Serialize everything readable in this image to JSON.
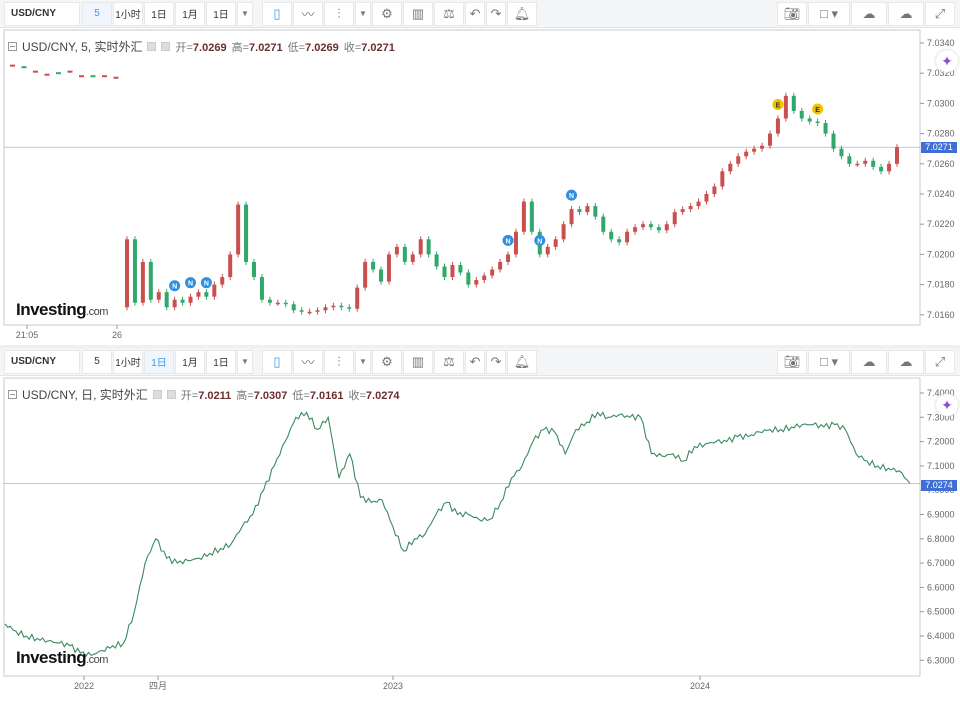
{
  "top": {
    "toolbar": {
      "symbol": "USD/CNY",
      "timeframes": [
        "5",
        "1小时",
        "1日",
        "1月",
        "1日"
      ],
      "active_tf": 0
    },
    "legend": {
      "title": "USD/CNY, 5, 实时外汇",
      "open_label": "开=",
      "open": "7.0269",
      "high_label": "高=",
      "high": "7.0271",
      "low_label": "低=",
      "low": "7.0269",
      "close_label": "收=",
      "close": "7.0271"
    },
    "logo": {
      "main": "Investing",
      "suffix": ".com"
    },
    "last_price": "7.0271"
  },
  "bottom": {
    "toolbar": {
      "symbol": "USD/CNY",
      "timeframes": [
        "5",
        "1小时",
        "1日",
        "1月",
        "1日"
      ],
      "active_tf": 2
    },
    "legend": {
      "title": "USD/CNY, 日, 实时外汇",
      "open_label": "开=",
      "open": "7.0211",
      "high_label": "高=",
      "high": "7.0307",
      "low_label": "低=",
      "low": "7.0161",
      "close_label": "收=",
      "close": "7.0274"
    },
    "logo": {
      "main": "Investing",
      "suffix": ".com"
    },
    "last_price": "7.0274"
  },
  "colors": {
    "up": "#c9504f",
    "down": "#2ea86b",
    "line": "#3a8a5f",
    "accent": "#3d9ae8",
    "last_price_bg": "#3d6fd6"
  },
  "chart_data": [
    {
      "type": "candlestick",
      "title": "USD/CNY, 5, 实时外汇",
      "ylim": [
        7.015,
        7.0345
      ],
      "y_ticks": [
        "7.0340",
        "7.0320",
        "7.0300",
        "7.0280",
        "7.0260",
        "7.0240",
        "7.0220",
        "7.0200",
        "7.0180",
        "7.0160"
      ],
      "x_ticks": [
        "21:05",
        "26"
      ],
      "prev_session_closes": [
        7.0325,
        7.0324,
        7.0321,
        7.0319,
        7.032,
        7.0321,
        7.0318,
        7.0318,
        7.0318,
        7.0317
      ],
      "closes": [
        7.021,
        7.0168,
        7.0195,
        7.017,
        7.0175,
        7.0165,
        7.017,
        7.0168,
        7.0172,
        7.0175,
        7.0172,
        7.018,
        7.0185,
        7.02,
        7.0233,
        7.0195,
        7.0185,
        7.017,
        7.0168,
        7.0168,
        7.0167,
        7.0163,
        7.0162,
        7.0162,
        7.0163,
        7.0165,
        7.0166,
        7.0165,
        7.0164,
        7.0178,
        7.0195,
        7.019,
        7.0182,
        7.02,
        7.0205,
        7.0195,
        7.02,
        7.021,
        7.02,
        7.0192,
        7.0185,
        7.0193,
        7.0188,
        7.018,
        7.0183,
        7.0186,
        7.019,
        7.0195,
        7.02,
        7.0215,
        7.0235,
        7.0215,
        7.02,
        7.0205,
        7.021,
        7.022,
        7.023,
        7.0228,
        7.0232,
        7.0225,
        7.0215,
        7.021,
        7.0208,
        7.0215,
        7.0218,
        7.022,
        7.0218,
        7.0216,
        7.022,
        7.0228,
        7.023,
        7.0232,
        7.0235,
        7.024,
        7.0245,
        7.0255,
        7.026,
        7.0265,
        7.0268,
        7.027,
        7.0272,
        7.028,
        7.029,
        7.0305,
        7.0295,
        7.029,
        7.0288,
        7.0287,
        7.028,
        7.027,
        7.0265,
        7.026,
        7.026,
        7.0262,
        7.0258,
        7.0255,
        7.026,
        7.0271
      ],
      "events": [
        {
          "label": "N",
          "index": 6
        },
        {
          "label": "N",
          "index": 8
        },
        {
          "label": "N",
          "index": 10
        },
        {
          "label": "N",
          "index": 48
        },
        {
          "label": "N",
          "index": 52
        },
        {
          "label": "N",
          "index": 56
        },
        {
          "label": "E",
          "index": 82
        },
        {
          "label": "E",
          "index": 87
        }
      ],
      "last": 7.0271
    },
    {
      "type": "line",
      "title": "USD/CNY, 日, 实时外汇",
      "ylim": [
        6.25,
        7.42
      ],
      "y_ticks": [
        "7.4000",
        "7.3000",
        "7.2000",
        "7.1000",
        "7.0000",
        "6.9000",
        "6.8000",
        "6.7000",
        "6.6000",
        "6.5000",
        "6.4000",
        "6.3000"
      ],
      "x_ticks": [
        "2022",
        "四月",
        "2023",
        "2024"
      ],
      "values": [
        6.45,
        6.42,
        6.4,
        6.39,
        6.38,
        6.37,
        6.36,
        6.33,
        6.32,
        6.34,
        6.36,
        6.37,
        6.5,
        6.7,
        6.8,
        6.72,
        6.7,
        6.71,
        6.72,
        6.74,
        6.76,
        6.78,
        6.85,
        6.9,
        7.0,
        7.1,
        7.2,
        7.3,
        7.32,
        7.25,
        7.3,
        7.05,
        7.15,
        6.97,
        6.95,
        6.96,
        6.85,
        6.75,
        6.8,
        6.82,
        6.9,
        6.95,
        6.9,
        6.9,
        6.88,
        6.88,
        6.95,
        7.05,
        7.1,
        7.2,
        7.25,
        7.24,
        7.15,
        7.25,
        7.28,
        7.32,
        7.3,
        7.31,
        7.3,
        7.3,
        7.15,
        7.14,
        7.15,
        7.12,
        7.18,
        7.19,
        7.2,
        7.2,
        7.22,
        7.22,
        7.24,
        7.25,
        7.25,
        7.26,
        7.27,
        7.27,
        7.26,
        7.27,
        7.25,
        7.15,
        7.12,
        7.1,
        7.09,
        7.08,
        7.027
      ],
      "last": 7.0274
    }
  ]
}
